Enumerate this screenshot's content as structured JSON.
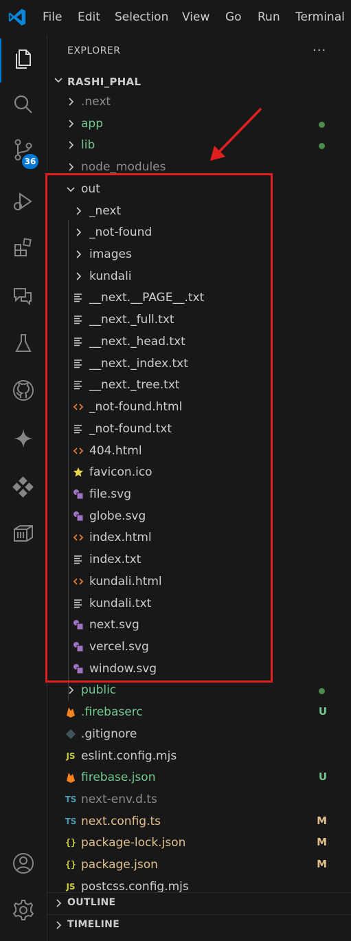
{
  "menubar": {
    "items": [
      "File",
      "Edit",
      "Selection",
      "View",
      "Go",
      "Run",
      "Terminal"
    ]
  },
  "activity_bar": {
    "items": [
      {
        "name": "explorer-icon",
        "active": true
      },
      {
        "name": "search-icon"
      },
      {
        "name": "source-control-icon",
        "badge": "36"
      },
      {
        "name": "run-debug-icon"
      },
      {
        "name": "extensions-icon"
      },
      {
        "name": "chat-icon"
      },
      {
        "name": "testing-icon"
      },
      {
        "name": "github-icon"
      },
      {
        "name": "copilot-icon"
      },
      {
        "name": "remote-explorer-icon"
      },
      {
        "name": "containers-icon"
      },
      {
        "name": "accounts-icon"
      },
      {
        "name": "settings-icon"
      }
    ]
  },
  "explorer": {
    "title": "EXPLORER",
    "more": "···",
    "root": "RASHI_PHAL",
    "items": [
      {
        "label": ".next",
        "type": "folder",
        "level": 1,
        "open": false,
        "color": "#8c8c8c"
      },
      {
        "label": "app",
        "type": "folder",
        "level": 1,
        "open": false,
        "color": "#73c991",
        "dot": true
      },
      {
        "label": "lib",
        "type": "folder",
        "level": 1,
        "open": false,
        "color": "#73c991",
        "dot": true
      },
      {
        "label": "node_modules",
        "type": "folder",
        "level": 1,
        "open": false,
        "color": "#8c8c8c"
      },
      {
        "label": "out",
        "type": "folder",
        "level": 1,
        "open": true,
        "color": "#cccccc"
      },
      {
        "label": "_next",
        "type": "folder",
        "level": 2,
        "open": false,
        "color": "#cccccc"
      },
      {
        "label": "_not-found",
        "type": "folder",
        "level": 2,
        "open": false,
        "color": "#cccccc"
      },
      {
        "label": "images",
        "type": "folder",
        "level": 2,
        "open": false,
        "color": "#cccccc"
      },
      {
        "label": "kundali",
        "type": "folder",
        "level": 2,
        "open": false,
        "color": "#cccccc"
      },
      {
        "label": "__next.__PAGE__.txt",
        "type": "txt",
        "level": 2,
        "color": "#cccccc"
      },
      {
        "label": "__next._full.txt",
        "type": "txt",
        "level": 2,
        "color": "#cccccc"
      },
      {
        "label": "__next._head.txt",
        "type": "txt",
        "level": 2,
        "color": "#cccccc"
      },
      {
        "label": "__next._index.txt",
        "type": "txt",
        "level": 2,
        "color": "#cccccc"
      },
      {
        "label": "__next._tree.txt",
        "type": "txt",
        "level": 2,
        "color": "#cccccc"
      },
      {
        "label": "_not-found.html",
        "type": "html",
        "level": 2,
        "color": "#cccccc"
      },
      {
        "label": "_not-found.txt",
        "type": "txt",
        "level": 2,
        "color": "#cccccc"
      },
      {
        "label": "404.html",
        "type": "html",
        "level": 2,
        "color": "#cccccc"
      },
      {
        "label": "favicon.ico",
        "type": "ico",
        "level": 2,
        "color": "#cccccc"
      },
      {
        "label": "file.svg",
        "type": "svg",
        "level": 2,
        "color": "#cccccc"
      },
      {
        "label": "globe.svg",
        "type": "svg",
        "level": 2,
        "color": "#cccccc"
      },
      {
        "label": "index.html",
        "type": "html",
        "level": 2,
        "color": "#cccccc"
      },
      {
        "label": "index.txt",
        "type": "txt",
        "level": 2,
        "color": "#cccccc"
      },
      {
        "label": "kundali.html",
        "type": "html",
        "level": 2,
        "color": "#cccccc"
      },
      {
        "label": "kundali.txt",
        "type": "txt",
        "level": 2,
        "color": "#cccccc"
      },
      {
        "label": "next.svg",
        "type": "svg",
        "level": 2,
        "color": "#cccccc"
      },
      {
        "label": "vercel.svg",
        "type": "svg",
        "level": 2,
        "color": "#cccccc"
      },
      {
        "label": "window.svg",
        "type": "svg",
        "level": 2,
        "color": "#cccccc"
      },
      {
        "label": "public",
        "type": "folder",
        "level": 1,
        "open": false,
        "color": "#73c991",
        "dot": true
      },
      {
        "label": ".firebaserc",
        "type": "firebase",
        "level": 1,
        "color": "#73c991",
        "status": "U",
        "status_color": "#73c991"
      },
      {
        "label": ".gitignore",
        "type": "git",
        "level": 1,
        "color": "#cccccc"
      },
      {
        "label": "eslint.config.mjs",
        "type": "js",
        "level": 1,
        "color": "#cccccc"
      },
      {
        "label": "firebase.json",
        "type": "firebase",
        "level": 1,
        "color": "#73c991",
        "status": "U",
        "status_color": "#73c991"
      },
      {
        "label": "next-env.d.ts",
        "type": "ts",
        "level": 1,
        "color": "#8c8c8c"
      },
      {
        "label": "next.config.ts",
        "type": "ts",
        "level": 1,
        "color": "#e2c08d",
        "status": "M",
        "status_color": "#e2c08d"
      },
      {
        "label": "package-lock.json",
        "type": "json",
        "level": 1,
        "color": "#e2c08d",
        "status": "M",
        "status_color": "#e2c08d"
      },
      {
        "label": "package.json",
        "type": "json",
        "level": 1,
        "color": "#e2c08d",
        "status": "M",
        "status_color": "#e2c08d"
      },
      {
        "label": "postcss.config.mjs",
        "type": "js",
        "level": 1,
        "color": "#cccccc"
      }
    ]
  },
  "sections": {
    "outline": "OUTLINE",
    "timeline": "TIMELINE"
  },
  "colors": {
    "accent": "#0078d4",
    "highlight_box": "#e02020",
    "untracked": "#73c991",
    "modified": "#e2c08d"
  }
}
